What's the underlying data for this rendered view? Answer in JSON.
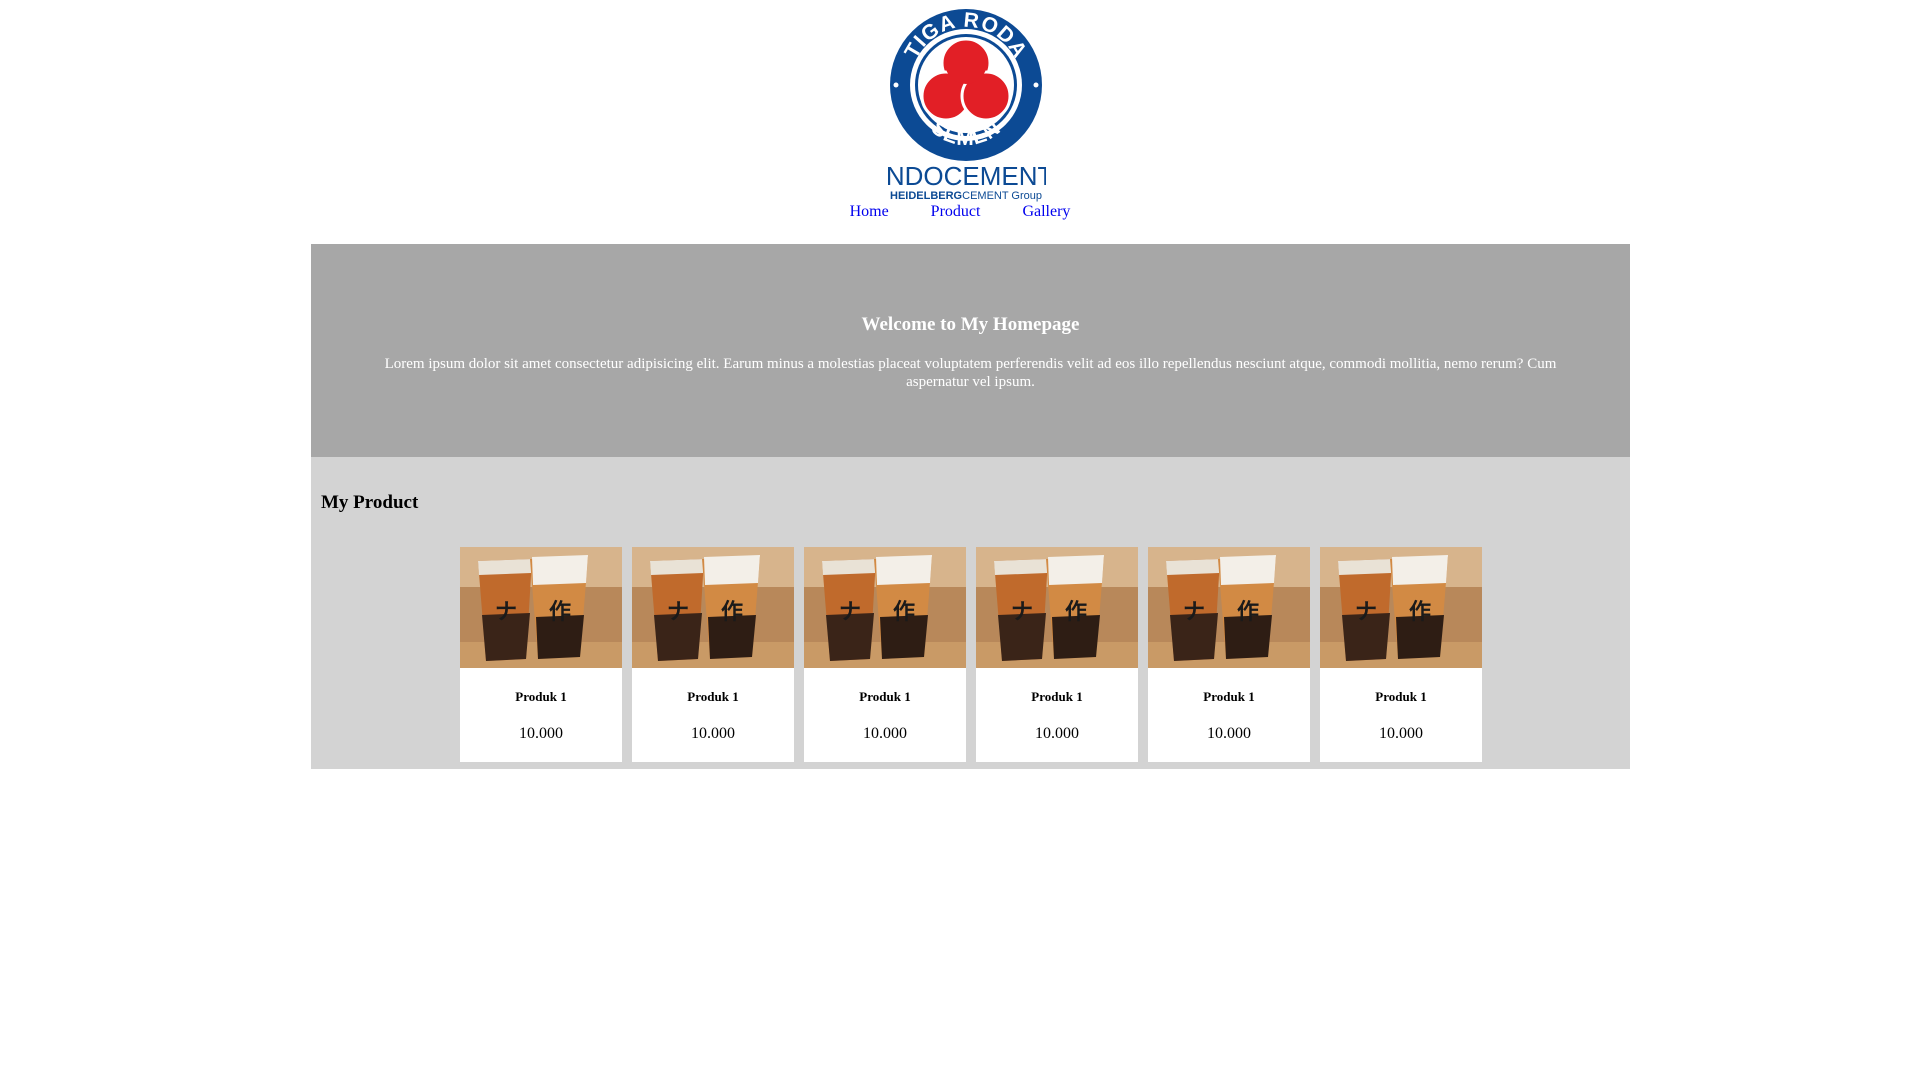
{
  "brand": {
    "ring_top": "TIGA RODA",
    "ring_bottom": "SEMEN",
    "wordmark": "INDOCEMENT",
    "group_bold": "HEIDELBERG",
    "group_rest": "CEMENT Group",
    "colors": {
      "blue": "#0c4a94",
      "red": "#e21f26"
    }
  },
  "nav": {
    "items": [
      {
        "label": "Home"
      },
      {
        "label": "Product"
      },
      {
        "label": "Gallery"
      }
    ]
  },
  "hero": {
    "title": "Welcome to My Homepage",
    "text": "Lorem ipsum dolor sit amet consectetur adipisicing elit. Earum minus a molestias placeat voluptatem perferendis velit ad eos illo repellendus nesciunt atque, commodi mollitia, nemo rerum? Cum aspernatur vel ipsum."
  },
  "products": {
    "title": "My Product",
    "items": [
      {
        "name": "Produk 1",
        "price": "10.000"
      },
      {
        "name": "Produk 1",
        "price": "10.000"
      },
      {
        "name": "Produk 1",
        "price": "10.000"
      },
      {
        "name": "Produk 1",
        "price": "10.000"
      },
      {
        "name": "Produk 1",
        "price": "10.000"
      },
      {
        "name": "Produk 1",
        "price": "10.000"
      }
    ]
  }
}
